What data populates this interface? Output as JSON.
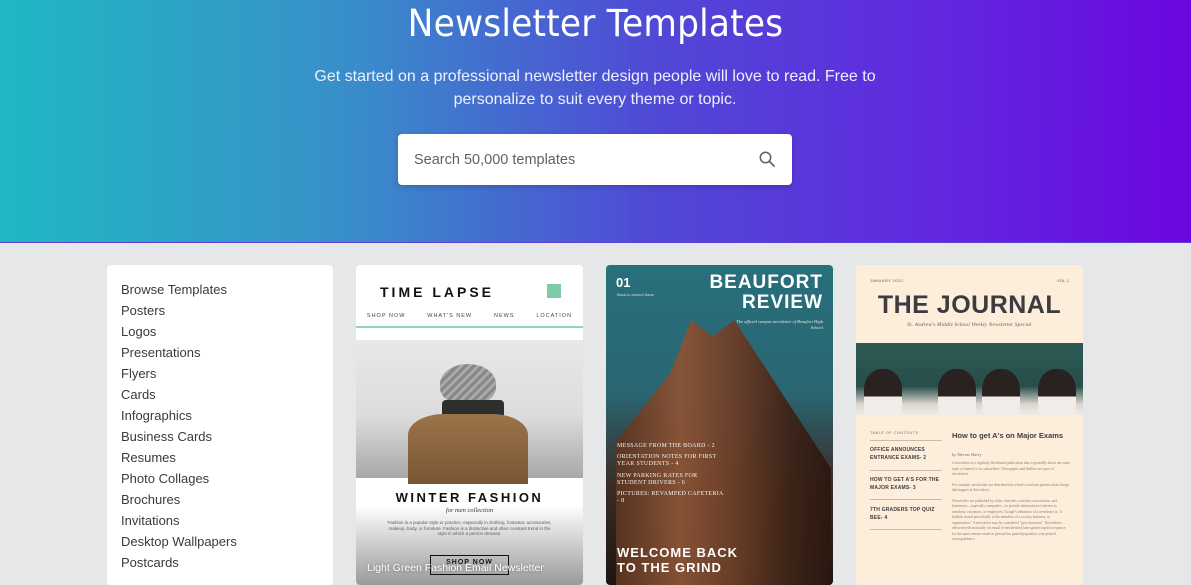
{
  "hero": {
    "title": "Newsletter Templates",
    "subtitle": "Get started on a professional newsletter design people will love to read. Free to personalize to suit every theme or topic.",
    "gradient_colors": [
      "#1fb8c3",
      "#5049d6",
      "#6c06e0"
    ]
  },
  "search": {
    "placeholder": "Search 50,000 templates",
    "value": "",
    "icon": "search-icon"
  },
  "sidebar": {
    "items": [
      {
        "label": "Browse Templates"
      },
      {
        "label": "Posters"
      },
      {
        "label": "Logos"
      },
      {
        "label": "Presentations"
      },
      {
        "label": "Flyers"
      },
      {
        "label": "Cards"
      },
      {
        "label": "Infographics"
      },
      {
        "label": "Business Cards"
      },
      {
        "label": "Resumes"
      },
      {
        "label": "Photo Collages"
      },
      {
        "label": "Brochures"
      },
      {
        "label": "Invitations"
      },
      {
        "label": "Desktop Wallpapers"
      },
      {
        "label": "Postcards"
      }
    ]
  },
  "templates": [
    {
      "name": "Light Green Fashion Email Newsletter",
      "brand": "TIME LAPSE",
      "nav": [
        "SHOP NOW",
        "WHAT'S NEW",
        "NEWS",
        "LOCATION"
      ],
      "headline": "WINTER FASHION",
      "subheadline": "for men collection",
      "body": "Fashion is a popular style or practice, especially in clothing, footwear, accessories, makeup, body, or furniture. Fashion is a distinctive and often constant trend in the style in which a person dresses.",
      "cta": "SHOP NOW",
      "accent": "#7fcaa6"
    },
    {
      "issue_number": "01",
      "issue_label": "Back-to-school Issue",
      "title_line1": "BEAUFORT",
      "title_line2": "REVIEW",
      "tagline": "The official campus newsletter of Beaufort High School",
      "toc": [
        "MESSAGE FROM THE BOARD - 2",
        "ORIENTATION NOTES FOR FIRST YEAR STUDENTS - 4",
        "NEW PARKING RATES FOR STUDENT DRIVERS - 6",
        "PICTURES: REVAMPED CAFETERIA - 8"
      ],
      "headline_line1": "WELCOME BACK",
      "headline_line2": "TO THE GRIND"
    },
    {
      "date": "JANUARY 2022",
      "volume": "VOL. 1",
      "title": "THE JOURNAL",
      "subtitle": "St. Andrew's Middle School Weekly Newsletter Special",
      "toc_heading": "TABLE OF CONTENTS",
      "toc": [
        "OFFICE ANNOUNCES ENTRANCE EXAMS- 2",
        "HOW TO GET A'S FOR THE MAJOR EXAMS- 3",
        "7TH GRADERS TOP QUIZ BEE- 4"
      ],
      "article_title": "How to get A's on Major Exams",
      "article_byline": "by Therese Harry",
      "article_paragraphs": [
        "A newsletter is a regularly distributed publication that is generally about one main topic of interest to its subscribers. Newspapers and leaflets are types of newsletters.",
        "For example, newsletters are distributed at schools to inform parents about things that happen in that school.",
        "Newsletters are published by clubs, churches, societies, associations, and businesses—especially companies—to provide information of interest to members, customers, or employees. Google's definition of a newsletter is, \"a bulletin issued periodically to the members of a society, business, or organization.\" A newsletter may be considered \"grey literature\". Newsletters delivered electronically via email (e-newsletters) have gained rapid acceptance for the same reasons email in general has gained popularity over printed correspondence."
      ]
    }
  ]
}
